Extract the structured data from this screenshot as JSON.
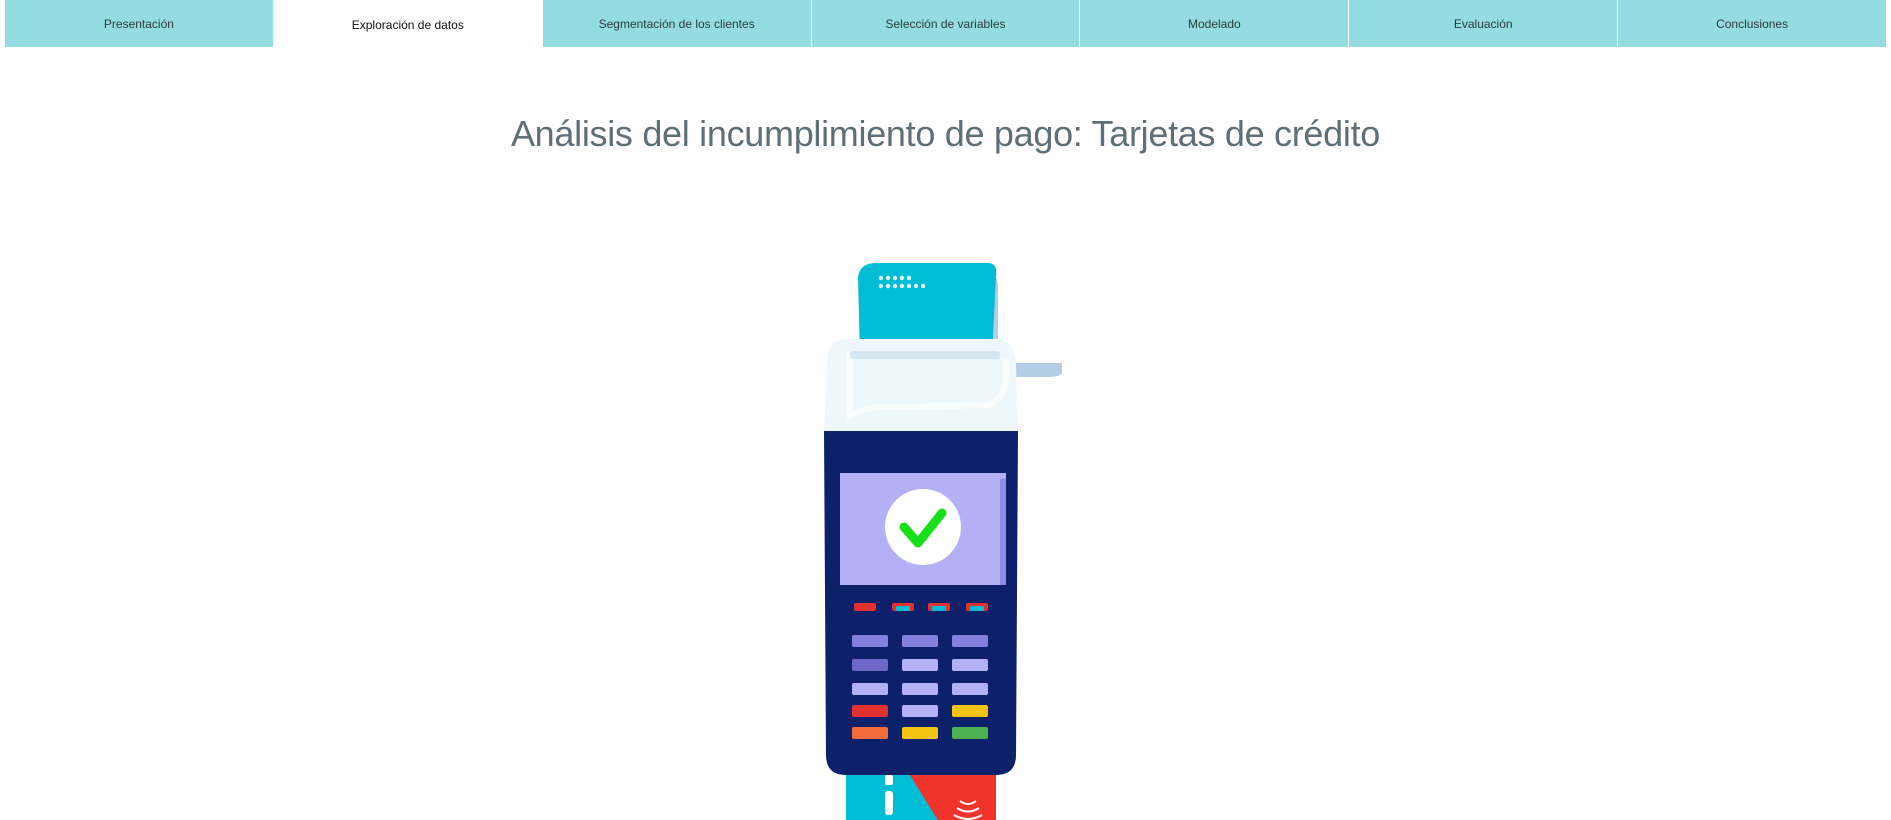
{
  "nav": {
    "tabs": [
      {
        "label": "Presentación",
        "active": false
      },
      {
        "label": "Exploración de datos",
        "active": true
      },
      {
        "label": "Segmentación de los clientes",
        "active": false
      },
      {
        "label": "Selección de variables",
        "active": false
      },
      {
        "label": "Modelado",
        "active": false
      },
      {
        "label": "Evaluación",
        "active": false
      },
      {
        "label": "Conclusiones",
        "active": false
      }
    ]
  },
  "page": {
    "title": "Análisis del incumplimiento de pago: Tarjetas de crédito"
  },
  "illustration": {
    "subject": "payment-terminal",
    "icon": "checkmark-icon"
  },
  "colors": {
    "tab_background": "#93dde0",
    "tab_active_background": "#ffffff",
    "title_color": "#5e6f77",
    "terminal_body": "#0c2169",
    "receipt": "#00bcd4",
    "screen": "#b3b0f5",
    "check": "#18e018"
  }
}
